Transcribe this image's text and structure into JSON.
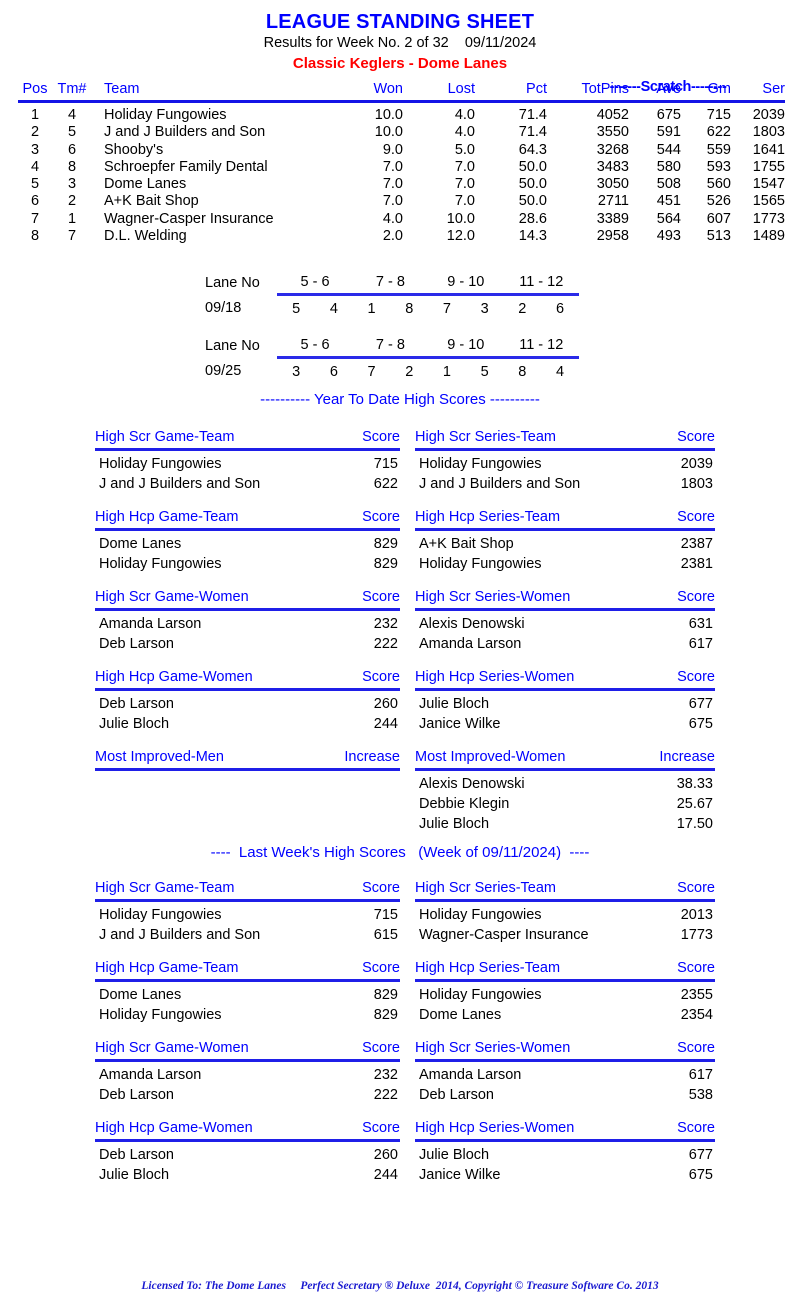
{
  "header": {
    "title": "LEAGUE STANDING SHEET",
    "subtitle": "Results for Week No. 2 of 32    09/11/2024",
    "league": "Classic Keglers - Dome Lanes",
    "title_color": "#0000ff",
    "league_color": "#ff0000"
  },
  "standings": {
    "scratch_band": "-------Scratch--------",
    "columns": {
      "pos": "Pos",
      "tm": "Tm#",
      "team": "Team",
      "won": "Won",
      "lost": "Lost",
      "pct": "Pct",
      "totpins": "TotPins",
      "ave": "Ave",
      "gm": "Gm",
      "ser": "Ser"
    },
    "rows": [
      {
        "pos": "1",
        "tm": "4",
        "team": "Holiday Fungowies",
        "won": "10.0",
        "lost": "4.0",
        "pct": "71.4",
        "totpins": "4052",
        "ave": "675",
        "gm": "715",
        "ser": "2039"
      },
      {
        "pos": "2",
        "tm": "5",
        "team": "J and J Builders and Son",
        "won": "10.0",
        "lost": "4.0",
        "pct": "71.4",
        "totpins": "3550",
        "ave": "591",
        "gm": "622",
        "ser": "1803"
      },
      {
        "pos": "3",
        "tm": "6",
        "team": "Shooby's",
        "won": "9.0",
        "lost": "5.0",
        "pct": "64.3",
        "totpins": "3268",
        "ave": "544",
        "gm": "559",
        "ser": "1641"
      },
      {
        "pos": "4",
        "tm": "8",
        "team": "Schroepfer Family Dental",
        "won": "7.0",
        "lost": "7.0",
        "pct": "50.0",
        "totpins": "3483",
        "ave": "580",
        "gm": "593",
        "ser": "1755"
      },
      {
        "pos": "5",
        "tm": "3",
        "team": "Dome Lanes",
        "won": "7.0",
        "lost": "7.0",
        "pct": "50.0",
        "totpins": "3050",
        "ave": "508",
        "gm": "560",
        "ser": "1547"
      },
      {
        "pos": "6",
        "tm": "2",
        "team": "A+K Bait Shop",
        "won": "7.0",
        "lost": "7.0",
        "pct": "50.0",
        "totpins": "2711",
        "ave": "451",
        "gm": "526",
        "ser": "1565"
      },
      {
        "pos": "7",
        "tm": "1",
        "team": "Wagner-Casper Insurance",
        "won": "4.0",
        "lost": "10.0",
        "pct": "28.6",
        "totpins": "3389",
        "ave": "564",
        "gm": "607",
        "ser": "1773"
      },
      {
        "pos": "8",
        "tm": "7",
        "team": "D.L. Welding",
        "won": "2.0",
        "lost": "12.0",
        "pct": "14.3",
        "totpins": "2958",
        "ave": "493",
        "gm": "513",
        "ser": "1489"
      }
    ]
  },
  "lane_schedules": [
    {
      "label": "Lane No",
      "date": "09/18",
      "pairs": [
        "5 - 6",
        "7 - 8",
        "9 - 10",
        "11 - 12"
      ],
      "matchups": [
        [
          "5",
          "4"
        ],
        [
          "1",
          "8"
        ],
        [
          "7",
          "3"
        ],
        [
          "2",
          "6"
        ]
      ]
    },
    {
      "label": "Lane No",
      "date": "09/25",
      "pairs": [
        "5 - 6",
        "7 - 8",
        "9 - 10",
        "11 - 12"
      ],
      "matchups": [
        [
          "3",
          "6"
        ],
        [
          "7",
          "2"
        ],
        [
          "1",
          "5"
        ],
        [
          "8",
          "4"
        ]
      ]
    }
  ],
  "ytd": {
    "banner": "---------- Year To Date High Scores ----------",
    "blocks": [
      {
        "left": {
          "title": "High Scr Game-Team",
          "value_header": "Score",
          "rows": [
            {
              "name": "Holiday Fungowies",
              "value": "715"
            },
            {
              "name": "J and J Builders and Son",
              "value": "622"
            }
          ]
        },
        "right": {
          "title": "High Scr Series-Team",
          "value_header": "Score",
          "rows": [
            {
              "name": "Holiday Fungowies",
              "value": "2039"
            },
            {
              "name": "J and J Builders and Son",
              "value": "1803"
            }
          ]
        }
      },
      {
        "left": {
          "title": "High Hcp Game-Team",
          "value_header": "Score",
          "rows": [
            {
              "name": "Dome Lanes",
              "value": "829"
            },
            {
              "name": "Holiday Fungowies",
              "value": "829"
            }
          ]
        },
        "right": {
          "title": "High Hcp Series-Team",
          "value_header": "Score",
          "rows": [
            {
              "name": "A+K Bait Shop",
              "value": "2387"
            },
            {
              "name": "Holiday Fungowies",
              "value": "2381"
            }
          ]
        }
      },
      {
        "left": {
          "title": "High Scr Game-Women",
          "value_header": "Score",
          "rows": [
            {
              "name": "Amanda Larson",
              "value": "232"
            },
            {
              "name": "Deb Larson",
              "value": "222"
            }
          ]
        },
        "right": {
          "title": "High Scr Series-Women",
          "value_header": "Score",
          "rows": [
            {
              "name": "Alexis Denowski",
              "value": "631"
            },
            {
              "name": "Amanda Larson",
              "value": "617"
            }
          ]
        }
      },
      {
        "left": {
          "title": "High Hcp Game-Women",
          "value_header": "Score",
          "rows": [
            {
              "name": "Deb Larson",
              "value": "260"
            },
            {
              "name": "Julie Bloch",
              "value": "244"
            }
          ]
        },
        "right": {
          "title": "High Hcp Series-Women",
          "value_header": "Score",
          "rows": [
            {
              "name": "Julie Bloch",
              "value": "677"
            },
            {
              "name": "Janice Wilke",
              "value": "675"
            }
          ]
        }
      },
      {
        "left": {
          "title": "Most Improved-Men",
          "value_header": "Increase",
          "rows": []
        },
        "right": {
          "title": "Most Improved-Women",
          "value_header": "Increase",
          "rows": [
            {
              "name": "Alexis Denowski",
              "value": "38.33"
            },
            {
              "name": "Debbie Klegin",
              "value": "25.67"
            },
            {
              "name": "Julie Bloch",
              "value": "17.50"
            }
          ]
        }
      }
    ]
  },
  "last_week": {
    "banner": "----  Last Week's High Scores   (Week of 09/11/2024)  ----",
    "blocks": [
      {
        "left": {
          "title": "High Scr Game-Team",
          "value_header": "Score",
          "rows": [
            {
              "name": "Holiday Fungowies",
              "value": "715"
            },
            {
              "name": "J and J Builders and Son",
              "value": "615"
            }
          ]
        },
        "right": {
          "title": "High Scr Series-Team",
          "value_header": "Score",
          "rows": [
            {
              "name": "Holiday Fungowies",
              "value": "2013"
            },
            {
              "name": "Wagner-Casper Insurance",
              "value": "1773"
            }
          ]
        }
      },
      {
        "left": {
          "title": "High Hcp Game-Team",
          "value_header": "Score",
          "rows": [
            {
              "name": "Dome Lanes",
              "value": "829"
            },
            {
              "name": "Holiday Fungowies",
              "value": "829"
            }
          ]
        },
        "right": {
          "title": "High Hcp Series-Team",
          "value_header": "Score",
          "rows": [
            {
              "name": "Holiday Fungowies",
              "value": "2355"
            },
            {
              "name": "Dome Lanes",
              "value": "2354"
            }
          ]
        }
      },
      {
        "left": {
          "title": "High Scr Game-Women",
          "value_header": "Score",
          "rows": [
            {
              "name": "Amanda Larson",
              "value": "232"
            },
            {
              "name": "Deb Larson",
              "value": "222"
            }
          ]
        },
        "right": {
          "title": "High Scr Series-Women",
          "value_header": "Score",
          "rows": [
            {
              "name": "Amanda Larson",
              "value": "617"
            },
            {
              "name": "Deb Larson",
              "value": "538"
            }
          ]
        }
      },
      {
        "left": {
          "title": "High Hcp Game-Women",
          "value_header": "Score",
          "rows": [
            {
              "name": "Deb Larson",
              "value": "260"
            },
            {
              "name": "Julie Bloch",
              "value": "244"
            }
          ]
        },
        "right": {
          "title": "High Hcp Series-Women",
          "value_header": "Score",
          "rows": [
            {
              "name": "Julie Bloch",
              "value": "677"
            },
            {
              "name": "Janice Wilke",
              "value": "675"
            }
          ]
        }
      }
    ]
  },
  "footer": {
    "text": "Licensed To: The Dome Lanes     Perfect Secretary ® Deluxe  2014, Copyright © Treasure Software Co. 2013"
  }
}
